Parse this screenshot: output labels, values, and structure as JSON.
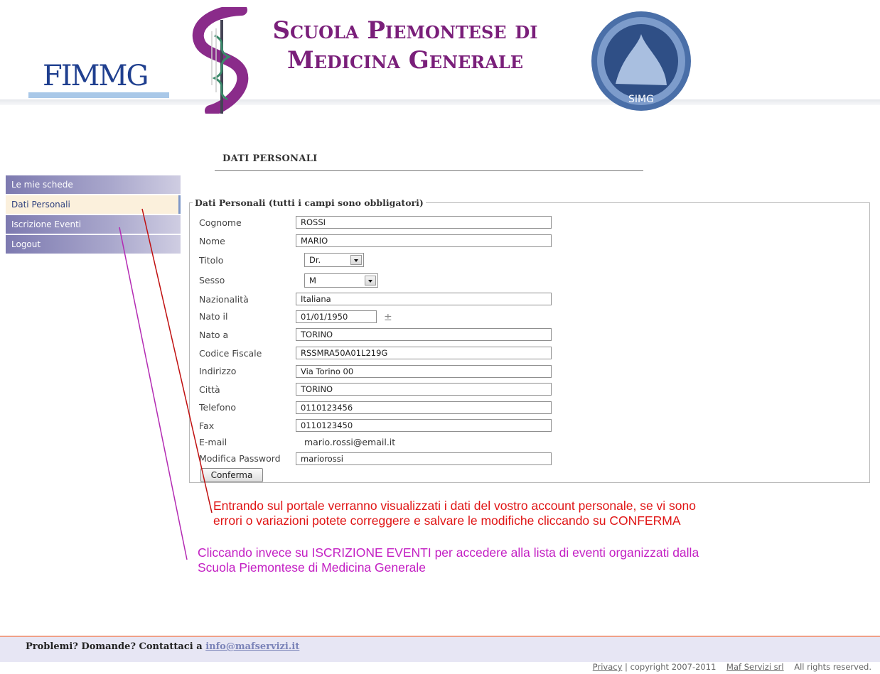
{
  "header": {
    "fimmg_logo": "FIMMG",
    "school_title_line1": "Scuola Piemontese di",
    "school_title_line2": "Medicina Generale",
    "seal_text": "SIMG"
  },
  "section_title": "DATI PERSONALI",
  "sidebar": {
    "items": [
      {
        "label": "Le mie schede",
        "active": false
      },
      {
        "label": "Dati Personali",
        "active": true
      },
      {
        "label": "Iscrizione Eventi",
        "active": false
      },
      {
        "label": "Logout",
        "active": false
      }
    ]
  },
  "form": {
    "legend": "Dati Personali (tutti i campi sono obbligatori)",
    "cognome": {
      "label": "Cognome",
      "value": "ROSSI"
    },
    "nome": {
      "label": "Nome",
      "value": "MARIO"
    },
    "titolo": {
      "label": "Titolo",
      "value": "Dr."
    },
    "sesso": {
      "label": "Sesso",
      "value": "M"
    },
    "nazionalita": {
      "label": "Nazionalità",
      "value": "Italiana"
    },
    "nato_il": {
      "label": "Nato il",
      "value": "01/01/1950"
    },
    "nato_a": {
      "label": "Nato a",
      "value": "TORINO"
    },
    "codice_fiscale": {
      "label": "Codice Fiscale",
      "value": "RSSMRA50A01L219G"
    },
    "indirizzo": {
      "label": "Indirizzo",
      "value": "Via Torino 00"
    },
    "citta": {
      "label": "Città",
      "value": "TORINO"
    },
    "telefono": {
      "label": "Telefono",
      "value": "0110123456"
    },
    "fax": {
      "label": "Fax",
      "value": "0110123450"
    },
    "email": {
      "label": "E-mail",
      "value": "mario.rossi@email.it"
    },
    "password": {
      "label": "Modifica Password",
      "value": "mariorossi"
    },
    "confirm_label": "Conferma"
  },
  "annotations": {
    "red_line1": "Entrando sul portale verranno visualizzati i dati del vostro account personale, se vi sono",
    "red_line2": "errori o variazioni potete correggere e salvare le modifiche cliccando su CONFERMA",
    "magenta_line1": "Cliccando invece su ISCRIZIONE EVENTI per accedere alla lista di eventi organizzati dalla",
    "magenta_line2": "Scuola Piemontese di Medicina Generale",
    "red_color": "#e01515",
    "magenta_color": "#c31fc3"
  },
  "footer": {
    "question": "Problemi? Domande? Contattaci a",
    "email": "info@mafservizi.it",
    "privacy": "Privacy",
    "separator": "|",
    "copyright": "copyright 2007-2011",
    "company": "Maf Servizi srl",
    "rights": "All rights reserved."
  }
}
